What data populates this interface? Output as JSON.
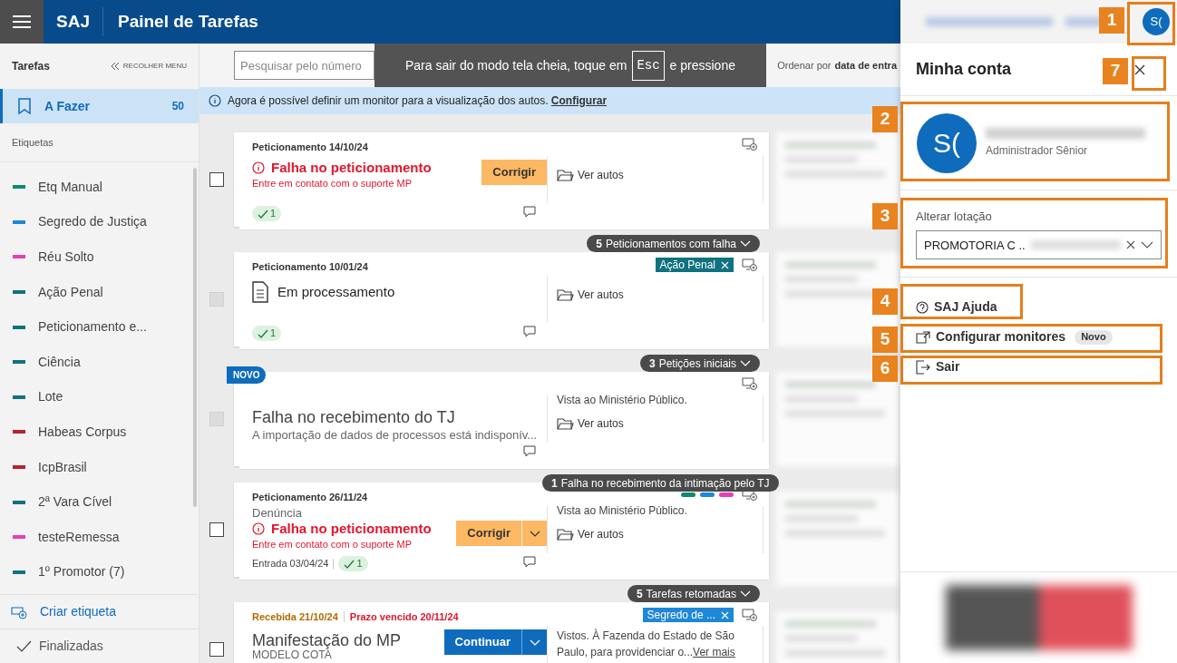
{
  "header": {
    "app": "SAJ",
    "title": "Painel de Tarefas",
    "avatar": "S("
  },
  "sidebar": {
    "heading": "Tarefas",
    "collapse": "RECOLHER MENU",
    "items": [
      {
        "label": "A Fazer",
        "count": "50",
        "selected": true
      }
    ],
    "labels_heading": "Etiquetas",
    "labels": [
      {
        "label": "Etq Manual",
        "color": "#0f8a6e"
      },
      {
        "label": "Segredo de Justiça",
        "color": "#1e88d8"
      },
      {
        "label": "Réu Solto",
        "color": "#e83eb4"
      },
      {
        "label": "Ação Penal",
        "color": "#0f7280"
      },
      {
        "label": "Peticionamento e...",
        "color": "#0f7280"
      },
      {
        "label": "Ciência",
        "color": "#0f7280"
      },
      {
        "label": "Lote",
        "color": "#0f7280"
      },
      {
        "label": "Habeas Corpus",
        "color": "#b3242b"
      },
      {
        "label": "IcpBrasil",
        "color": "#b3242b"
      },
      {
        "label": "2ª Vara Cível",
        "color": "#0f7280"
      },
      {
        "label": "testeRemessa",
        "color": "#e83eb4"
      },
      {
        "label": "1º Promotor (7)",
        "color": "#0f7280"
      }
    ],
    "create": "Criar etiqueta",
    "finished": "Finalizadas"
  },
  "toolbar": {
    "search_placeholder": "Pesquisar pelo número",
    "sort_label": "Ordenar por",
    "sort_value": "data de entra"
  },
  "banner": {
    "text": "Agora é possível definir um monitor para a visualização dos autos.",
    "link": "Configurar"
  },
  "fullscreen_notice": {
    "before": "Para sair do modo tela cheia, toque em",
    "key": "Esc",
    "after": "e pressione"
  },
  "cards": [
    {
      "header": [
        {
          "text": "Peticionamento 14/10/24",
          "kind": "plain"
        }
      ],
      "disabled": false,
      "kind": "error",
      "title": "Falha no peticionamento",
      "message": "Entre em contato com o suporte MP",
      "action": {
        "label": "Corrigir",
        "kind": "warning",
        "split": false
      },
      "badge": "1",
      "link": "Ver autos",
      "group": {
        "count": "5",
        "label": "Peticionamentos com falha"
      }
    },
    {
      "header": [
        {
          "text": "Peticionamento 10/01/24",
          "kind": "plain"
        }
      ],
      "tags": [
        {
          "label": "Ação Penal",
          "color": "#0f7280"
        }
      ],
      "disabled": true,
      "kind": "processing",
      "title": "Em processamento",
      "badge": "1",
      "link": "Ver autos",
      "group": {
        "count": "3",
        "label": "Petições iniciais"
      }
    },
    {
      "new_badge": "NOVO",
      "disabled": true,
      "kind": "notice",
      "title": "Falha no recebimento do TJ",
      "message": "A importação de dados de processos está indisponív...",
      "note": "Vista ao Ministério Público.",
      "link": "Ver autos",
      "group": {
        "count": "1",
        "label": "Falha no recebimento da intimação pelo TJ"
      }
    },
    {
      "header": [
        {
          "text": "Peticionamento 26/11/24",
          "kind": "plain"
        }
      ],
      "dots": [
        {
          "color": "#0f8a6e"
        },
        {
          "color": "#1e88d8"
        },
        {
          "color": "#e83eb4"
        }
      ],
      "disabled": false,
      "subtitle": "Denúncia",
      "kind": "error",
      "title": "Falha no peticionamento",
      "message": "Entre em contato com o suporte MP",
      "action": {
        "label": "Corrigir",
        "kind": "warning",
        "split": true
      },
      "entry": "Entrada 03/04/24",
      "badge": "1",
      "note": "Vista ao Ministério Público.",
      "link": "Ver autos",
      "group": {
        "count": "5",
        "label": "Tarefas retomadas"
      }
    },
    {
      "header": [
        {
          "text": "Recebida 21/10/24",
          "kind": "received"
        },
        {
          "text": "Prazo vencido 20/11/24",
          "kind": "overdue"
        }
      ],
      "tags": [
        {
          "label": "Segredo de ...",
          "color": "#1e88d8"
        }
      ],
      "disabled": false,
      "kind": "task",
      "title": "Manifestação do MP",
      "message": "MODELO COTA",
      "action": {
        "label": "Continuar",
        "kind": "primary",
        "split": true
      },
      "note": "Vistos. À Fazenda do Estado de São Paulo, para providenciar o...",
      "more": "Ver mais"
    }
  ],
  "account": {
    "avatar": "S(",
    "title": "Minha conta",
    "role": "Administrador Sênior",
    "field_label": "Alterar lotação",
    "field_value": "PROMOTORIA C ..",
    "menu": [
      {
        "label": "SAJ Ajuda",
        "kind": "help"
      },
      {
        "label": "Configurar monitores",
        "kind": "monitor",
        "badge": "Novo"
      },
      {
        "label": "Sair",
        "kind": "exit"
      }
    ]
  },
  "annotations": [
    {
      "number": "1"
    },
    {
      "number": "2"
    },
    {
      "number": "3"
    },
    {
      "number": "4"
    },
    {
      "number": "5"
    },
    {
      "number": "6"
    },
    {
      "number": "7"
    }
  ]
}
